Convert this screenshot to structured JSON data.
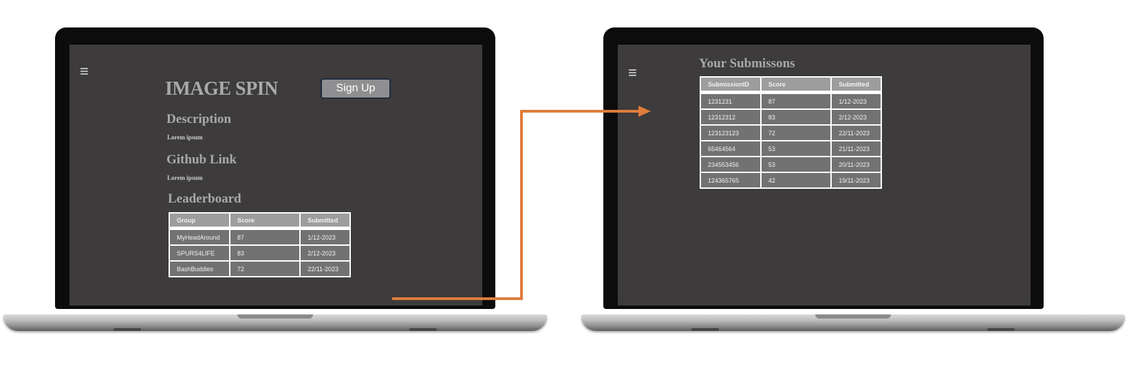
{
  "left_screen": {
    "menu_icon": "hamburger-icon",
    "menu_glyph": "≡",
    "title": "IMAGE SPIN",
    "signup_label": "Sign Up",
    "description_heading": "Description",
    "description_text": "Lorem ipsum",
    "github_heading": "Github Link",
    "github_text": "Lorem ipsum",
    "leaderboard_heading": "Leaderboard",
    "leaderboard": {
      "columns": [
        "Group",
        "Score",
        "Submitted"
      ],
      "rows": [
        [
          "MyHeadAround",
          "87",
          "1/12-2023"
        ],
        [
          "SPURS4LIFE",
          "83",
          "2/12-2023"
        ],
        [
          "BashBuddies",
          "72",
          "22/11-2023"
        ]
      ]
    }
  },
  "right_screen": {
    "menu_icon": "hamburger-icon",
    "menu_glyph": "≡",
    "title": "Your Submissons",
    "submissions": {
      "columns": [
        "SubmissionID",
        "Score",
        "Submitted"
      ],
      "rows": [
        [
          "1231231",
          "87",
          "1/12-2023"
        ],
        [
          "12312312",
          "83",
          "2/12-2023"
        ],
        [
          "123123123",
          "72",
          "22/11-2023"
        ],
        [
          "65464564",
          "53",
          "21/11-2023"
        ],
        [
          "234553456",
          "53",
          "20/11-2023"
        ],
        [
          "124365765",
          "42",
          "19/11-2023"
        ]
      ]
    }
  },
  "colors": {
    "screen_bg": "#3d3b3c",
    "heading_text": "#a9a9a9",
    "table_header": "#9d9d9d",
    "table_cell": "#737272",
    "flow_arrow": "#e07c3a"
  }
}
